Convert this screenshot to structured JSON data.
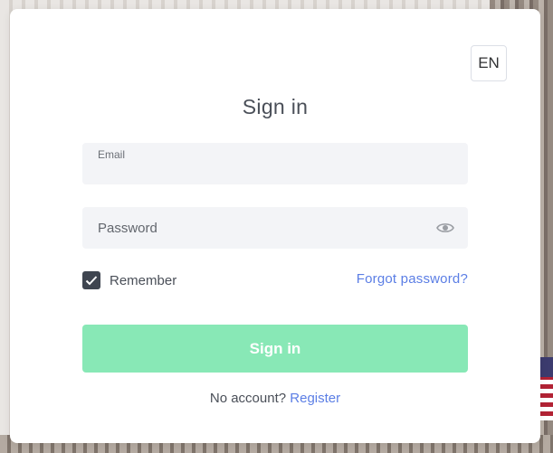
{
  "language": {
    "label": "EN"
  },
  "form": {
    "title": "Sign in",
    "email": {
      "label": "Email",
      "value": ""
    },
    "password": {
      "placeholder": "Password",
      "value": ""
    },
    "remember": {
      "label": "Remember",
      "checked": true
    },
    "forgot_label": "Forgot password?",
    "submit_label": "Sign in",
    "no_account_text": "No account?",
    "register_label": "Register"
  },
  "colors": {
    "accent_button": "#88e8b6",
    "link": "#5b7ee5",
    "checkbox": "#3f4550"
  },
  "icons": {
    "password_toggle": "eye-icon",
    "checkbox_mark": "checkmark-icon"
  }
}
